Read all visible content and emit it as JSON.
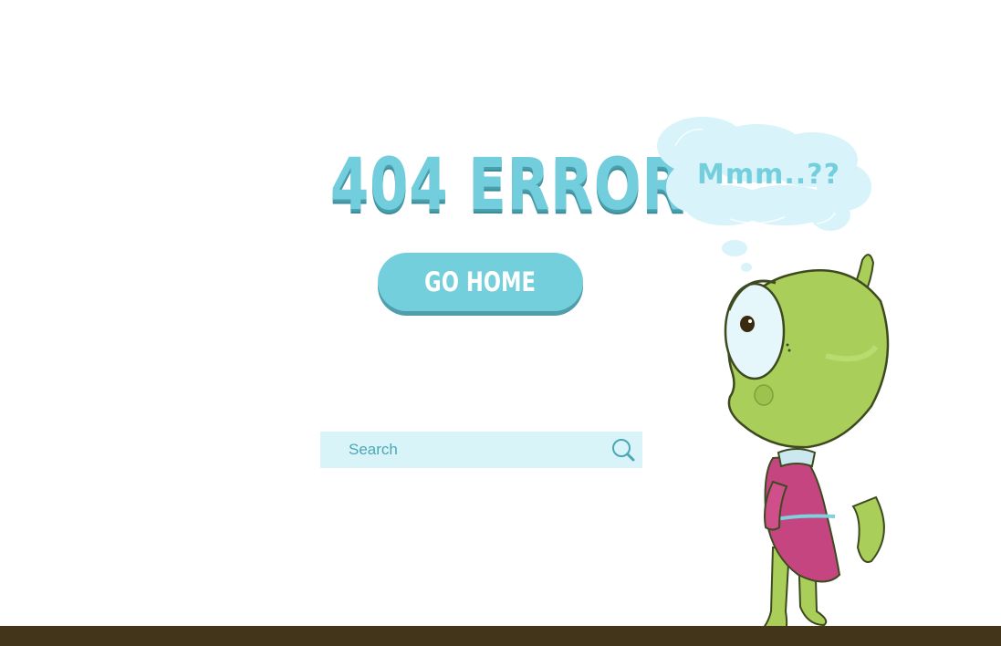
{
  "error_title": "404 ERROR",
  "go_home_label": "GO HOME",
  "search": {
    "placeholder": "Search",
    "icon": "magnifier-icon"
  },
  "thought_bubble_text": "Mmm..??",
  "colors": {
    "accent": "#74cfdd",
    "accent_shadow": "#4e9fab",
    "search_bg": "#d9f4f9",
    "cloud": "#d8f3f9",
    "alien_skin": "#a9cf5a",
    "sweater": "#c4457f",
    "ground": "#433519"
  }
}
